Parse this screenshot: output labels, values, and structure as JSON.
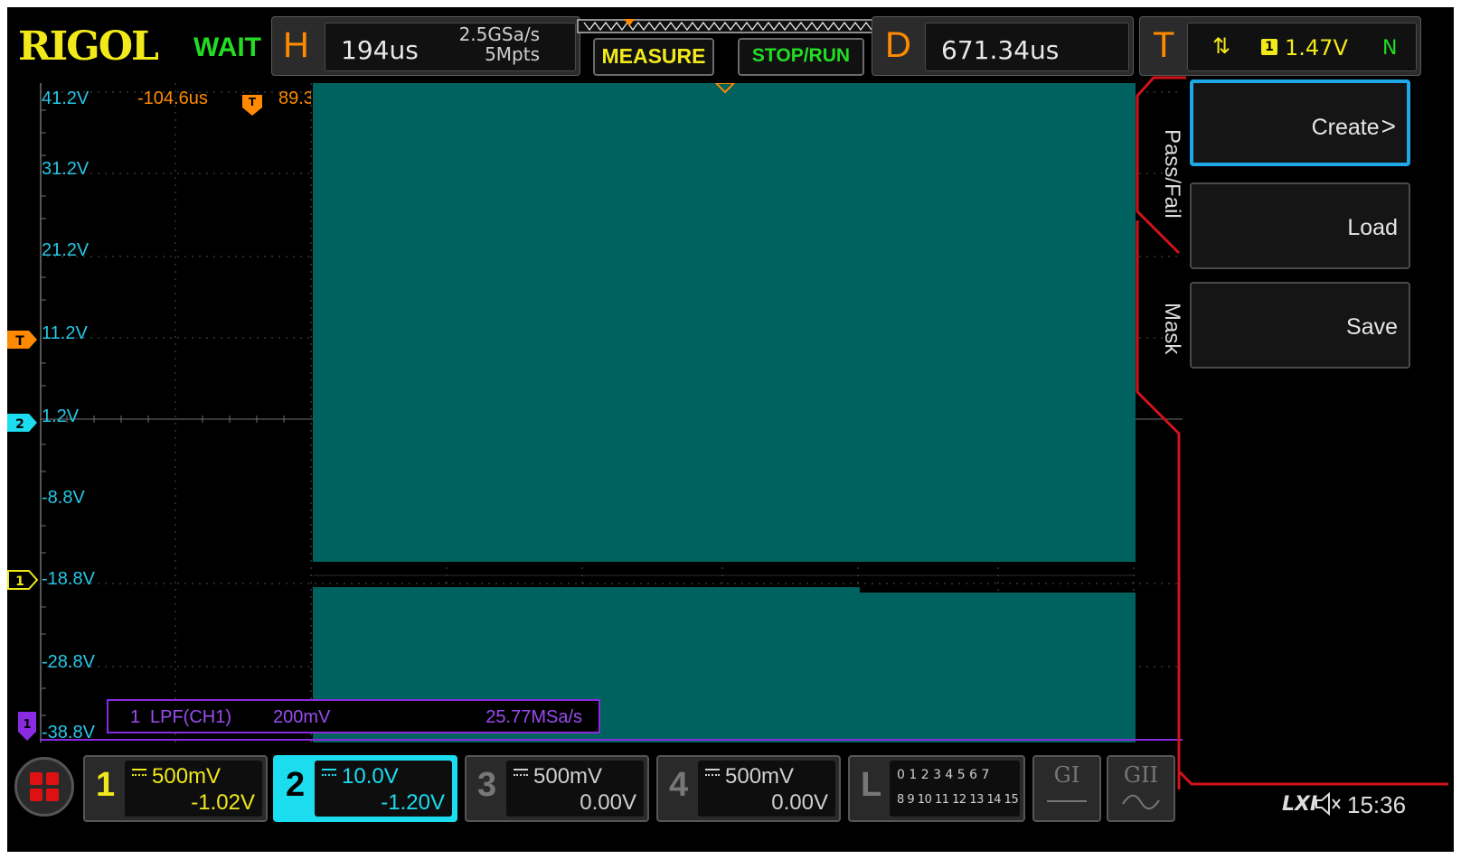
{
  "brand": "RIGOL",
  "run_state": "WAIT",
  "horizontal": {
    "letter": "H",
    "timebase": "194us",
    "sample_rate": "2.5GSa/s",
    "memory_depth": "5Mpts"
  },
  "buttons": {
    "measure": "MEASURE",
    "stop_run": "STOP/RUN"
  },
  "delay": {
    "letter": "D",
    "value": "671.34us"
  },
  "trigger": {
    "letter": "T",
    "edge_symbol": "⇅",
    "source": "1",
    "level": "1.47V",
    "mode": "N"
  },
  "cursor": {
    "time_a": "-104.6us",
    "time_b": "89.3"
  },
  "volt_labels": [
    "41.2V",
    "31.2V",
    "21.2V",
    "11.2V",
    "1.2V",
    "-8.8V",
    "-18.8V",
    "-28.8V",
    "-38.8V"
  ],
  "markers": {
    "trigger": "T",
    "ch2": "2",
    "ch1": "1",
    "math": "1"
  },
  "math_info": {
    "id": "1",
    "name": "LPF(CH1)",
    "scale": "200mV",
    "rate": "25.77MSa/s"
  },
  "side_tabs": {
    "pass_fail": "Pass/Fail",
    "mask": "Mask"
  },
  "menu": {
    "create": "Create",
    "load": "Load",
    "save": "Save"
  },
  "channels": [
    {
      "num": "1",
      "scale": "500mV",
      "offset": "-1.02V"
    },
    {
      "num": "2",
      "scale": "10.0V",
      "offset": "-1.20V"
    },
    {
      "num": "3",
      "scale": "500mV",
      "offset": "0.00V"
    },
    {
      "num": "4",
      "scale": "500mV",
      "offset": "0.00V"
    }
  ],
  "logic": {
    "letter": "L",
    "row1": "0 1 2 3  4 5 6 7",
    "row2": "8  9 10 11  12 13 14 15"
  },
  "gen": {
    "g1": "GI",
    "g2": "GII"
  },
  "status": {
    "lxi": "LXI",
    "time": "15:36"
  },
  "colors": {
    "ch1": "#f0e81a",
    "ch2": "#1cdcf0",
    "ch3": "#b06cff",
    "ch4": "#3a82ff",
    "trace_fill": "#00625e",
    "orange": "#ff8a00",
    "math": "#8a2be2",
    "frame_red": "#d0141a",
    "select_blue": "#1fa8e8"
  }
}
